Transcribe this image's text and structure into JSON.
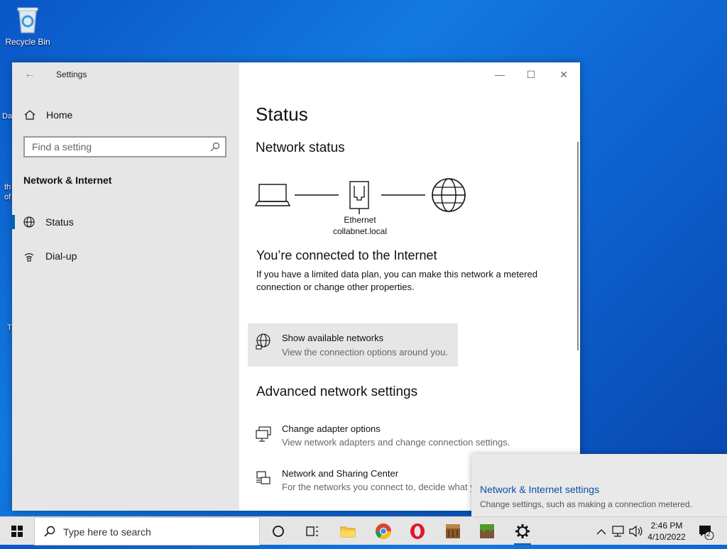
{
  "desktop": {
    "recycle_bin_label": "Recycle Bin",
    "fragments": [
      "Da",
      "th",
      "of",
      "T"
    ]
  },
  "window": {
    "app_title": "Settings",
    "back_glyph": "←",
    "controls": {
      "minimize": "—",
      "maximize": "☐",
      "close": "✕"
    }
  },
  "sidebar": {
    "home_label": "Home",
    "search_placeholder": "Find a setting",
    "section_title": "Network & Internet",
    "items": [
      {
        "label": "Status",
        "icon": "globe-icon",
        "active": true
      },
      {
        "label": "Dial-up",
        "icon": "dialup-icon",
        "active": false
      }
    ]
  },
  "content": {
    "page_title": "Status",
    "network_status_heading": "Network status",
    "adapter_name": "Ethernet",
    "network_name": "collabnet.local",
    "connected_heading": "You’re connected to the Internet",
    "connected_desc": "If you have a limited data plan, you can make this network a metered connection or change other properties.",
    "show_networks": {
      "title": "Show available networks",
      "desc": "View the connection options around you."
    },
    "advanced_heading": "Advanced network settings",
    "advanced_items": [
      {
        "title": "Change adapter options",
        "desc": "View network adapters and change connection settings.",
        "icon": "adapter-icon"
      },
      {
        "title": "Network and Sharing Center",
        "desc": "For the networks you connect to, decide what you want to share.",
        "icon": "sharing-center-icon"
      }
    ]
  },
  "toast": {
    "title": "Network & Internet settings",
    "desc": "Change settings, such as making a connection metered."
  },
  "taskbar": {
    "search_placeholder": "Type here to search",
    "time": "2:46 PM",
    "date": "4/10/2022",
    "notification_count": "2",
    "accent_color": "#0063b1"
  }
}
